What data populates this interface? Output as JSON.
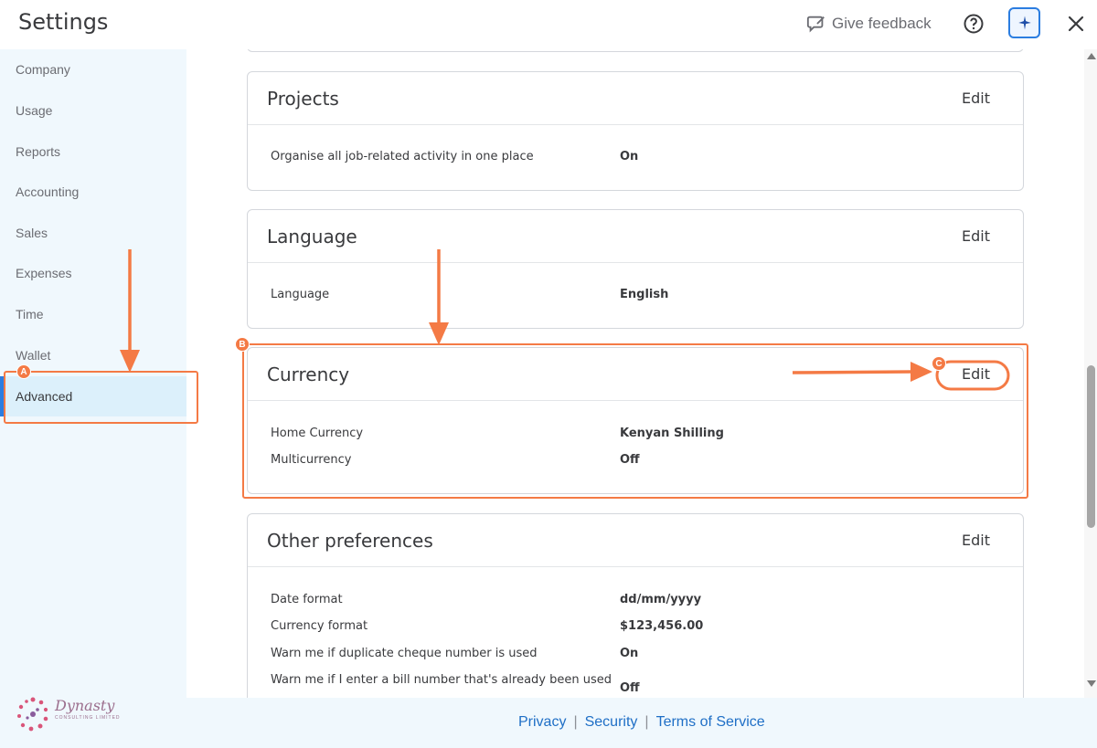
{
  "header": {
    "title": "Settings",
    "feedback_label": "Give feedback",
    "icons": [
      "feedback-icon",
      "help-icon",
      "assistant-icon",
      "close-icon"
    ]
  },
  "sidebar": {
    "items": [
      {
        "label": "Company"
      },
      {
        "label": "Usage"
      },
      {
        "label": "Reports"
      },
      {
        "label": "Accounting"
      },
      {
        "label": "Sales"
      },
      {
        "label": "Expenses"
      },
      {
        "label": "Time"
      },
      {
        "label": "Wallet"
      },
      {
        "label": "Advanced",
        "active": true
      }
    ]
  },
  "cards": {
    "projects": {
      "title": "Projects",
      "edit": "Edit",
      "rows": [
        {
          "label": "Organise all job-related activity in one place",
          "value": "On"
        }
      ]
    },
    "language": {
      "title": "Language",
      "edit": "Edit",
      "rows": [
        {
          "label": "Language",
          "value": "English"
        }
      ]
    },
    "currency": {
      "title": "Currency",
      "edit": "Edit",
      "rows": [
        {
          "label": "Home Currency",
          "value": "Kenyan Shilling"
        },
        {
          "label": "Multicurrency",
          "value": "Off"
        }
      ]
    },
    "other": {
      "title": "Other preferences",
      "edit": "Edit",
      "rows": [
        {
          "label": "Date format",
          "value": "dd/mm/yyyy"
        },
        {
          "label": "Currency format",
          "value": "$123,456.00"
        },
        {
          "label": "Warn me if duplicate cheque number is used",
          "value": "On"
        },
        {
          "label": "Warn me if I enter a bill number that's already been used",
          "value": "Off"
        }
      ]
    }
  },
  "footer": {
    "links": [
      "Privacy",
      "Security",
      "Terms of Service"
    ],
    "separator": "|"
  },
  "brand": {
    "name": "Dynasty",
    "tagline": "CONSULTING LIMITED"
  },
  "annotations": {
    "badges": [
      "A",
      "B",
      "C"
    ],
    "color": "#f47a45"
  },
  "colors": {
    "accent": "#2b7de0",
    "link": "#1f6fc6",
    "sidebar_bg": "#f0f8fd",
    "active_bg": "#dcf0fb"
  }
}
